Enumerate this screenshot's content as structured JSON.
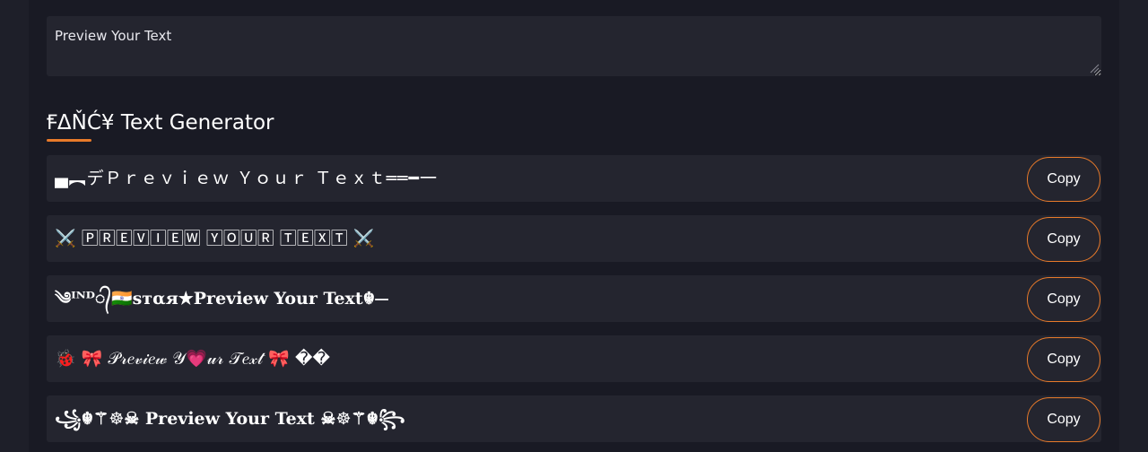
{
  "preview": {
    "value": "Preview Your Text"
  },
  "section": {
    "title": "ꞘΔŇĆ¥ Text Generator"
  },
  "styles": [
    {
      "text": "▄︻デＰｒｅｖｉｅｗ Ｙｏｕｒ Ｔｅｘｔ══━一",
      "copy_label": "Copy"
    },
    {
      "text": "⚔️ 🄿🅁🄴🅅🄸🄴🅆 🅈🄾🅄🅁 🅃🄴🅇🅃 ⚔️",
      "copy_label": "Copy"
    },
    {
      "text": "༄ᴵᴺᴰ᭄🇮🇳ѕтαя★Preview Your Text☬⏤",
      "copy_label": "Copy"
    },
    {
      "text": "🐞 🎀 𝒫𝓇𝑒𝓋𝒾𝑒𝓌 𝒴💗𝓊𝓇 𝒯𝑒𝓍𝓉 🎀 ��",
      "copy_label": "Copy"
    },
    {
      "text": "꧁☬⚚☸☠ Preview Your Text ☠☸⚚☬꧂",
      "copy_label": "Copy"
    }
  ],
  "colors": {
    "accent": "#e87a2a",
    "background": "#191a24",
    "row": "#24252f"
  }
}
